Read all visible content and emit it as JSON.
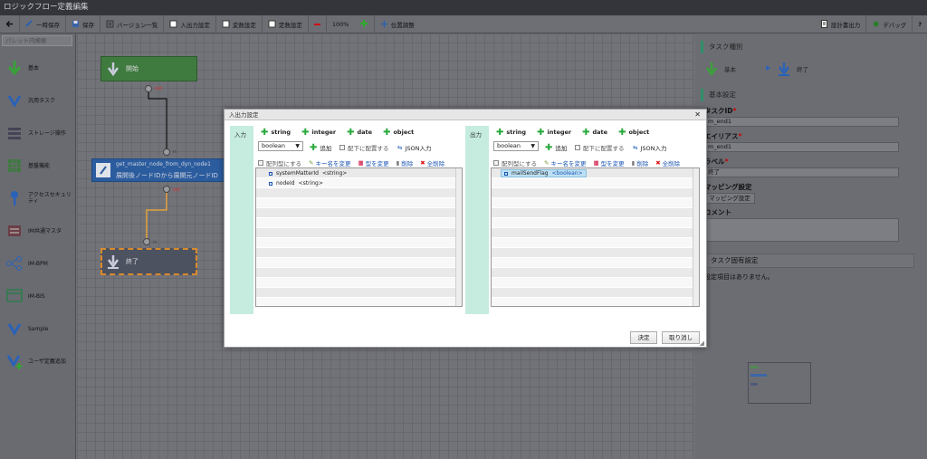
{
  "window": {
    "title": "ロジックフロー定義編集"
  },
  "toolbar": {
    "back_label": "",
    "save_temp": "一時保存",
    "save": "保存",
    "versions": "バージョン一覧",
    "io_settings": "入出力設定",
    "variables": "変数設定",
    "constants": "定数設定",
    "zoom": "100%",
    "align": "位置調整",
    "design_output": "設計書出力",
    "debug": "デバッグ",
    "help": "?"
  },
  "palette": {
    "search_placeholder": "パレット内検索",
    "items": [
      {
        "label": "基本",
        "icon": "arrow-down-green-icon"
      },
      {
        "label": "汎用タスク",
        "icon": "arrow-down-blue-icon"
      },
      {
        "label": "ストレージ操作",
        "icon": "storage-icon"
      },
      {
        "label": "基盤機能",
        "icon": "grid-icon"
      },
      {
        "label": "アクセスセキュリティ",
        "icon": "key-icon"
      },
      {
        "label": "IM共通マスタ",
        "icon": "master-icon"
      },
      {
        "label": "IM-BPM",
        "icon": "bpm-icon"
      },
      {
        "label": "IM-BIS",
        "icon": "bis-icon"
      },
      {
        "label": "Sample",
        "icon": "arrow-down-blue-icon"
      },
      {
        "label": "ユーザ定義追加",
        "icon": "user-defined-add-icon"
      }
    ]
  },
  "canvas": {
    "start_label": "開始",
    "start_port": "out",
    "task_in": "in",
    "task_title": "get_master_node_from_dyn_node1",
    "task_desc": "展開後ノードIDから展開元ノードID",
    "task_out": "out",
    "end_in": "in",
    "end_label": "終了"
  },
  "right_panel": {
    "task_type_header": "タスク種別",
    "type_basic": "基本",
    "type_end": "終了",
    "basic_settings_header": "基本設定",
    "task_id_label": "タスクID",
    "task_id_value": "m_end1",
    "alias_label": "エイリアス",
    "alias_value": "m_end1",
    "label_label": "ラベル",
    "label_value": "終了",
    "mapping_label": "マッピング設定",
    "mapping_button": "マッピング設定",
    "comment_label": "コメント",
    "specific_header": "タスク固有設定",
    "specific_note": "設定項目はありません。"
  },
  "modal": {
    "title": "入出力設定",
    "input": {
      "side_label": "入力",
      "types": [
        "string",
        "integer",
        "date",
        "object"
      ],
      "select_value": "boolean",
      "add": "追加",
      "place_under": "配下に配置する",
      "json_input": "JSON入力",
      "make_array": "配列型にする",
      "rename": "キー名を変更",
      "change_type": "型を変更",
      "delete": "削除",
      "delete_all": "全削除",
      "nodes": [
        {
          "name": "systemMatterId",
          "type": "<string>"
        },
        {
          "name": "nodeId",
          "type": "<string>"
        }
      ]
    },
    "output": {
      "side_label": "出力",
      "types": [
        "string",
        "integer",
        "date",
        "object"
      ],
      "select_value": "boolean",
      "add": "追加",
      "place_under": "配下に配置する",
      "json_input": "JSON入力",
      "make_array": "配列型にする",
      "rename": "キー名を変更",
      "change_type": "型を変更",
      "delete": "削除",
      "delete_all": "全削除",
      "nodes": [
        {
          "name": "mailSendFlag",
          "type": "<boolean>"
        }
      ]
    },
    "ok_button": "決定",
    "cancel_button": "取り消し"
  }
}
